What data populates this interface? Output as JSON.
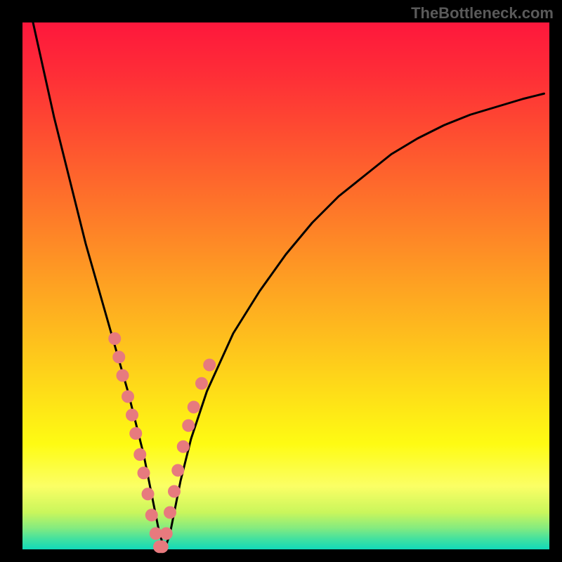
{
  "watermark": "TheBottleneck.com",
  "colors": {
    "black": "#000000",
    "dot": "#e77a7e",
    "gradient_stops": [
      {
        "offset": 0.0,
        "color": "#fe173c"
      },
      {
        "offset": 0.1,
        "color": "#fe2e37"
      },
      {
        "offset": 0.2,
        "color": "#fe4a31"
      },
      {
        "offset": 0.3,
        "color": "#fe672c"
      },
      {
        "offset": 0.4,
        "color": "#fe8427"
      },
      {
        "offset": 0.5,
        "color": "#fea222"
      },
      {
        "offset": 0.6,
        "color": "#febf1d"
      },
      {
        "offset": 0.7,
        "color": "#fedd18"
      },
      {
        "offset": 0.8,
        "color": "#fefb13"
      },
      {
        "offset": 0.88,
        "color": "#fbff65"
      },
      {
        "offset": 0.93,
        "color": "#c9f65c"
      },
      {
        "offset": 0.96,
        "color": "#83eb80"
      },
      {
        "offset": 0.98,
        "color": "#43e19f"
      },
      {
        "offset": 1.0,
        "color": "#11d9b9"
      }
    ]
  },
  "chart_data": {
    "type": "line",
    "title": "",
    "xlabel": "",
    "ylabel": "",
    "xlim": [
      0,
      100
    ],
    "ylim": [
      0,
      100
    ],
    "series": [
      {
        "name": "curve",
        "x": [
          2,
          4,
          6,
          8,
          10,
          12,
          14,
          16,
          18,
          20,
          21,
          22,
          23,
          24,
          25,
          26,
          27,
          28,
          29,
          30,
          32,
          35,
          40,
          45,
          50,
          55,
          60,
          65,
          70,
          75,
          80,
          85,
          90,
          95,
          99
        ],
        "y": [
          100,
          91,
          82,
          74,
          66,
          58,
          51,
          44,
          37,
          30,
          26,
          22,
          18,
          13,
          8,
          3,
          0,
          3,
          8,
          13,
          21,
          30,
          41,
          49,
          56,
          62,
          67,
          71,
          75,
          78,
          80.5,
          82.5,
          84,
          85.5,
          86.5
        ]
      }
    ],
    "highlight_points": {
      "x": [
        17.5,
        18.3,
        19.0,
        20.0,
        20.8,
        21.5,
        22.3,
        23.0,
        23.8,
        24.5,
        25.3,
        26.0,
        26.5,
        27.3,
        28.0,
        28.8,
        29.5,
        30.5,
        31.5,
        32.5,
        34.0,
        35.5
      ],
      "y": [
        40.0,
        36.5,
        33.0,
        29.0,
        25.5,
        22.0,
        18.0,
        14.5,
        10.5,
        6.5,
        3.0,
        0.5,
        0.5,
        3.0,
        7.0,
        11.0,
        15.0,
        19.5,
        23.5,
        27.0,
        31.5,
        35.0
      ]
    },
    "vertex_x": 26.3
  }
}
